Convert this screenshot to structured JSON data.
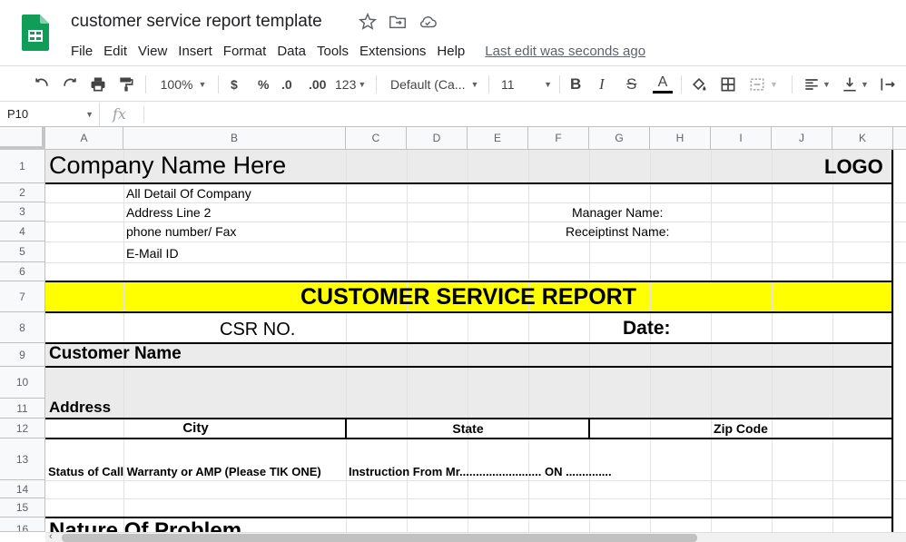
{
  "app": {
    "doc_title": "customer service report template",
    "menu": [
      "File",
      "Edit",
      "View",
      "Insert",
      "Format",
      "Data",
      "Tools",
      "Extensions",
      "Help"
    ],
    "last_edit": "Last edit was seconds ago",
    "brand_color": "#0f9d58"
  },
  "toolbar": {
    "zoom": "100%",
    "currency": "$",
    "percent": "%",
    "dec_decrease": ".0",
    "dec_increase": ".00",
    "more_formats": "123",
    "font": "Default (Ca...",
    "font_size": "11",
    "bold": "B",
    "italic": "I",
    "strike": "S",
    "text_color_letter": "A"
  },
  "formula_bar": {
    "cell_ref": "P10",
    "fx": "fx",
    "content": ""
  },
  "columns": [
    "A",
    "B",
    "C",
    "D",
    "E",
    "F",
    "G",
    "H",
    "I",
    "J",
    "K"
  ],
  "rows": [
    "1",
    "2",
    "3",
    "4",
    "5",
    "6",
    "7",
    "8",
    "9",
    "10",
    "11",
    "12",
    "13",
    "14",
    "15",
    "16"
  ],
  "sheet": {
    "company_name": "Company Name Here",
    "logo": "LOGO",
    "detail": "All Detail Of Company",
    "address_line": "Address Line 2",
    "phone": "phone number/ Fax",
    "email": "E-Mail ID",
    "manager": "Manager Name:",
    "receptionist": "Receiptinst Name:",
    "report_title": "CUSTOMER SERVICE REPORT",
    "csr_no": "CSR NO.",
    "date": "Date:",
    "customer_name": "Customer Name",
    "address": "Address",
    "city": "City",
    "state": "State",
    "zip": "Zip Code",
    "status_call": "Status of Call Warranty or AMP (Please TIK ONE)",
    "instruction": "Instruction From  Mr......................... ON ..............",
    "nature_partial": "Nature Of Problem"
  },
  "colors": {
    "report_title_bg": "#ffff00",
    "shaded_bg": "#ebebeb",
    "header_bg": "#f8f9fa"
  }
}
